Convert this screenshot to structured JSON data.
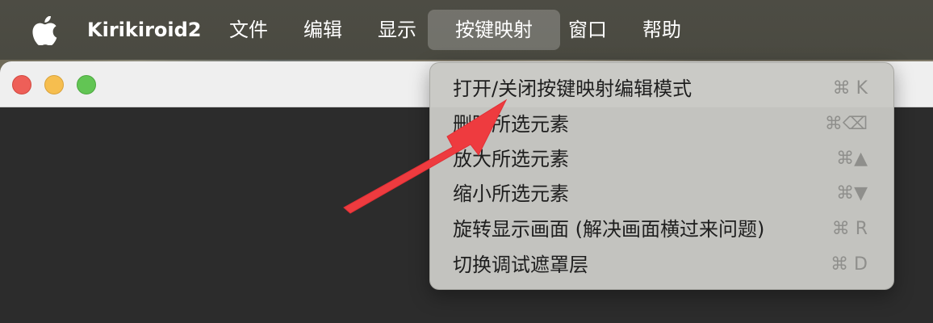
{
  "menubar": {
    "app_name": "Kirikiroid2",
    "items": [
      {
        "label": "文件"
      },
      {
        "label": "编辑"
      },
      {
        "label": "显示"
      },
      {
        "label": "按键映射"
      },
      {
        "label": "窗口"
      },
      {
        "label": "帮助"
      }
    ],
    "active_item": "按键映射"
  },
  "dropdown": {
    "items": [
      {
        "label": "打开/关闭按键映射编辑模式",
        "shortcut": "⌘ K"
      },
      {
        "label": "删除所选元素",
        "shortcut": "⌘⌫"
      },
      {
        "label": "放大所选元素",
        "shortcut": "⌘▲"
      },
      {
        "label": "缩小所选元素",
        "shortcut": "⌘▼"
      },
      {
        "label": "旋转显示画面 (解决画面横过来问题)",
        "shortcut": "⌘ R"
      },
      {
        "label": "切换调试遮罩层",
        "shortcut": "⌘ D"
      }
    ]
  },
  "colors": {
    "menubar_bg": "#4b4a42",
    "dropdown_bg": "#c8c8c4",
    "arrow": "#ee3b3f",
    "close": "#ee5f58",
    "minimize": "#f6be4f",
    "zoom": "#62c554"
  },
  "icons": [
    "apple-icon",
    "close-button",
    "minimize-button",
    "zoom-button",
    "red-arrow-annotation"
  ]
}
